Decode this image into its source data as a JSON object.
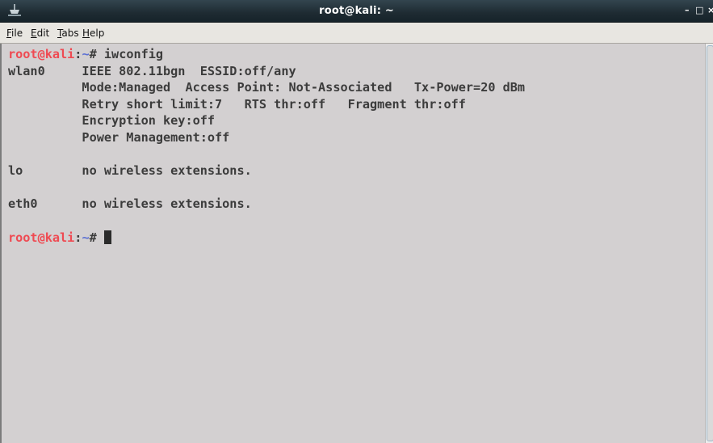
{
  "window": {
    "title": "root@kali: ~",
    "icon": "terminal-icon",
    "controls": {
      "minimize": "–",
      "maximize": "□",
      "close": "×"
    }
  },
  "menu": {
    "file": {
      "accel": "F",
      "rest": "ile"
    },
    "edit": {
      "accel": "E",
      "rest": "dit"
    },
    "tabs": {
      "accel": "T",
      "rest": "abs"
    },
    "help": {
      "accel": "H",
      "rest": "elp"
    }
  },
  "terminal": {
    "prompt": {
      "user": "root@kali",
      "colon": ":",
      "path": "~",
      "hash": "# "
    },
    "command": "iwconfig",
    "output": [
      "wlan0     IEEE 802.11bgn  ESSID:off/any",
      "          Mode:Managed  Access Point: Not-Associated   Tx-Power=20 dBm",
      "          Retry short limit:7   RTS thr:off   Fragment thr:off",
      "          Encryption key:off",
      "          Power Management:off",
      "",
      "lo        no wireless extensions.",
      "",
      "eth0      no wireless extensions.",
      ""
    ]
  },
  "colors": {
    "background": "#d3d0d1",
    "text": "#3c3c3c",
    "prompt_user": "#ef4a52",
    "prompt_path": "#5b6fd3",
    "titlebar": "#1e2b32"
  }
}
